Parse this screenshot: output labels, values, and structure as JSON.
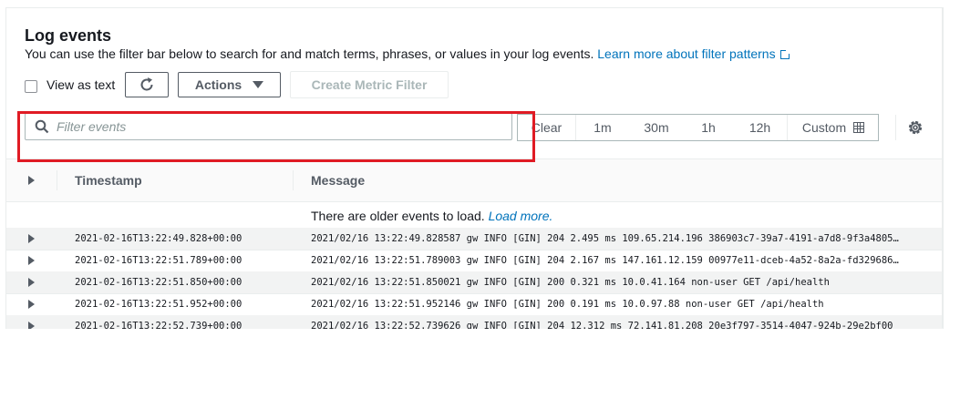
{
  "header": {
    "title": "Log events",
    "description": "You can use the filter bar below to search for and match terms, phrases, or values in your log events.",
    "learn_more": "Learn more about filter patterns"
  },
  "toolbar": {
    "view_as_text": "View as text",
    "actions_label": "Actions",
    "create_metric_filter": "Create Metric Filter"
  },
  "search": {
    "placeholder": "Filter events"
  },
  "time_range": {
    "clear": "Clear",
    "opt_1m": "1m",
    "opt_30m": "30m",
    "opt_1h": "1h",
    "opt_12h": "12h",
    "custom": "Custom"
  },
  "table": {
    "columns": {
      "timestamp": "Timestamp",
      "message": "Message"
    },
    "older_events_text": "There are older events to load.",
    "load_more": "Load more.",
    "rows": [
      {
        "timestamp": "2021-02-16T13:22:49.828+00:00",
        "message": "2021/02/16 13:22:49.828587 gw INFO [GIN] 204 2.495 ms 109.65.214.196 386903c7-39a7-4191-a7d8-9f3a4805…"
      },
      {
        "timestamp": "2021-02-16T13:22:51.789+00:00",
        "message": "2021/02/16 13:22:51.789003 gw INFO [GIN] 204 2.167 ms 147.161.12.159 00977e11-dceb-4a52-8a2a-fd329686…"
      },
      {
        "timestamp": "2021-02-16T13:22:51.850+00:00",
        "message": "2021/02/16 13:22:51.850021 gw INFO [GIN] 200 0.321 ms 10.0.41.164 non-user GET /api/health"
      },
      {
        "timestamp": "2021-02-16T13:22:51.952+00:00",
        "message": "2021/02/16 13:22:51.952146 gw INFO [GIN] 200 0.191 ms 10.0.97.88 non-user GET /api/health"
      },
      {
        "timestamp": "2021-02-16T13:22:52.739+00:00",
        "message": "2021/02/16 13:22:52.739626 gw INFO [GIN] 204 12.312 ms 72.141.81.208 20e3f797-3514-4047-924b-29e2bf00"
      }
    ]
  },
  "colors": {
    "link": "#0073bb",
    "highlight_box": "#e01b24",
    "text": "#16191f",
    "muted": "#545b64"
  },
  "icons": [
    "refresh-icon",
    "caret-down-icon",
    "search-icon",
    "calendar-icon",
    "settings-gear-icon",
    "external-link-icon",
    "expand-caret-icon"
  ]
}
